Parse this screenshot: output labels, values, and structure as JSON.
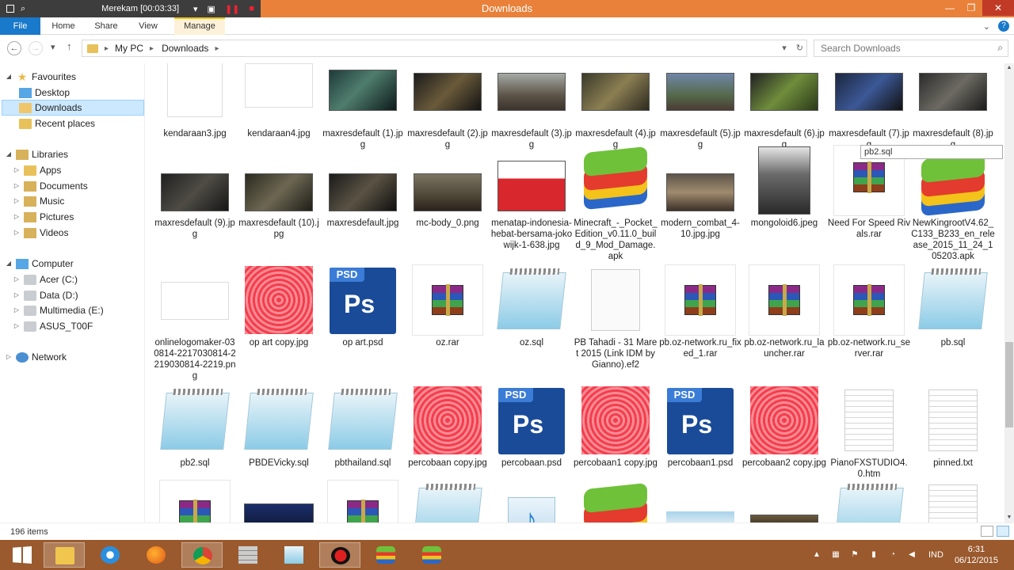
{
  "recorder": {
    "label": "Merekam [00:03:33]"
  },
  "window": {
    "title": "Downloads",
    "min": "—",
    "max": "❐",
    "close": "✕"
  },
  "ribbon": {
    "tabs": [
      {
        "label": "File"
      },
      {
        "label": "Home"
      },
      {
        "label": "Share"
      },
      {
        "label": "View"
      },
      {
        "label": "Manage"
      }
    ],
    "collapse_glyph": "⌄",
    "help_glyph": "?"
  },
  "nav": {
    "back_glyph": "←",
    "forward_glyph": "→",
    "recent_glyph": "▾",
    "up_glyph": "↑",
    "breadcrumbs": [
      "My PC",
      "Downloads"
    ],
    "sep_glyph": "▸",
    "dropdown_glyph": "▾",
    "refresh_glyph": "↻",
    "search_placeholder": "Search Downloads",
    "search_glyph": "⌕"
  },
  "sidebar": {
    "items": [
      {
        "label": "Favourites",
        "icon": "star-icon"
      },
      {
        "label": "Desktop",
        "icon": "desktop-icon"
      },
      {
        "label": "Downloads",
        "icon": "downloads-folder-icon"
      },
      {
        "label": "Recent places",
        "icon": "recent-places-icon"
      },
      {
        "label": "Libraries",
        "icon": "libraries-icon"
      },
      {
        "label": "Apps",
        "icon": "folder-icon"
      },
      {
        "label": "Documents",
        "icon": "documents-icon"
      },
      {
        "label": "Music",
        "icon": "music-icon"
      },
      {
        "label": "Pictures",
        "icon": "pictures-icon"
      },
      {
        "label": "Videos",
        "icon": "videos-icon"
      },
      {
        "label": "Computer",
        "icon": "computer-icon"
      },
      {
        "label": "Acer (C:)",
        "icon": "drive-icon"
      },
      {
        "label": "Data (D:)",
        "icon": "drive-icon"
      },
      {
        "label": "Multimedia (E:)",
        "icon": "drive-icon"
      },
      {
        "label": "ASUS_T00F",
        "icon": "phone-icon"
      },
      {
        "label": "Network",
        "icon": "network-icon"
      }
    ],
    "expand_glyph": "▷",
    "collapse_glyph": "◢"
  },
  "files": {
    "row1": [
      {
        "name": "kendaraan3.jpg",
        "icon": "cartoon"
      },
      {
        "name": "kendaraan4.jpg",
        "icon": "cartoon2"
      },
      {
        "name": "maxresdefault (1).jpg",
        "icon": "game1"
      },
      {
        "name": "maxresdefault (2).jpg",
        "icon": "game2"
      },
      {
        "name": "maxresdefault (3).jpg",
        "icon": "game3"
      },
      {
        "name": "maxresdefault (4).jpg",
        "icon": "game4"
      },
      {
        "name": "maxresdefault (5).jpg",
        "icon": "game5"
      },
      {
        "name": "maxresdefault (6).jpg",
        "icon": "game6"
      },
      {
        "name": "maxresdefault (7).jpg",
        "icon": "game7"
      },
      {
        "name": "maxresdefault (8).jpg",
        "icon": "game8"
      }
    ],
    "row2": [
      {
        "name": "maxresdefault (9).jpg",
        "icon": "game9"
      },
      {
        "name": "maxresdefault (10).jpg",
        "icon": "game10"
      },
      {
        "name": "maxresdefault.jpg",
        "icon": "game11"
      },
      {
        "name": "mc-body_0.png",
        "icon": "game12"
      },
      {
        "name": "menatap-indonesia-hebat-bersama-jokowijk-1-638.jpg",
        "icon": "poster"
      },
      {
        "name": "Minecraft_-_Pocket_Edition_v0.11.0_build_9_Mod_Damage.apk",
        "icon": "bluestacks"
      },
      {
        "name": "modern_combat_4-10.jpg.jpg",
        "icon": "game13"
      },
      {
        "name": "mongoloid6.jpeg",
        "icon": "portrait"
      },
      {
        "name": "Need For Speed Rivals.rar",
        "icon": "rar"
      },
      {
        "name": "NewKingrootV4.62_C133_B233_en_release_2015_11_24_105203.apk",
        "icon": "bluestacks"
      }
    ],
    "row3": [
      {
        "name": "onlinelogomaker-030814-2217030814-2219030814-2219.png",
        "icon": "logo"
      },
      {
        "name": "op art copy.jpg",
        "icon": "opart"
      },
      {
        "name": "op art.psd",
        "icon": "psd"
      },
      {
        "name": "oz.rar",
        "icon": "rar"
      },
      {
        "name": "oz.sql",
        "icon": "notepad"
      },
      {
        "name": "PB Tahadi - 31 Maret 2015 (Link IDM by Gianno).ef2",
        "icon": "doc"
      },
      {
        "name": "pb.oz-network.ru_fixed_1.rar",
        "icon": "rar"
      },
      {
        "name": "pb.oz-network.ru_launcher.rar",
        "icon": "rar"
      },
      {
        "name": "pb.oz-network.ru_server.rar",
        "icon": "rar"
      },
      {
        "name": "pb.sql",
        "icon": "notepad"
      }
    ],
    "row4": [
      {
        "name": "pb2.sql",
        "icon": "notepad"
      },
      {
        "name": "PBDEVicky.sql",
        "icon": "notepad"
      },
      {
        "name": "pbthailand.sql",
        "icon": "notepad"
      },
      {
        "name": "percobaan copy.jpg",
        "icon": "opart"
      },
      {
        "name": "percobaan.psd",
        "icon": "psd"
      },
      {
        "name": "percobaan1 copy.jpg",
        "icon": "opart"
      },
      {
        "name": "percobaan1.psd",
        "icon": "psd"
      },
      {
        "name": "percobaan2 copy.jpg",
        "icon": "opart"
      },
      {
        "name": "PianoFXSTUDIO4.0.htm",
        "icon": "doclines"
      },
      {
        "name": "pinned.txt",
        "icon": "doclines"
      }
    ]
  },
  "rename_tooltip": "pb2.sql",
  "status": {
    "item_count": "196 items"
  },
  "taskbar": {
    "items": [
      "start",
      "file-explorer",
      "internet-explorer",
      "firefox",
      "chrome",
      "brick-app",
      "notepad",
      "recorder",
      "bluestacks",
      "bluestacks-2"
    ]
  },
  "tray": {
    "lang": "IND",
    "time": "6:31",
    "date": "06/12/2015"
  }
}
